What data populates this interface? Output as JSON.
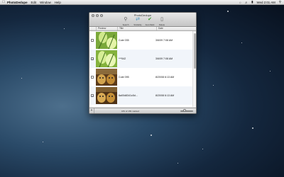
{
  "menubar": {
    "app_name": "PhotoDedupe",
    "menus": [
      "Edit",
      "Window",
      "Help"
    ],
    "clock": "Wed 2:01 AM"
  },
  "window": {
    "title": "PhotoDedupe",
    "toolbar": [
      {
        "label": "Search",
        "icon": "search-icon"
      },
      {
        "label": "Similarity",
        "icon": "similarity-icon"
      },
      {
        "label": "Auto Mark",
        "icon": "auto-mark-icon"
      },
      {
        "label": "Delete",
        "icon": "trash-icon"
      }
    ],
    "columns": [
      "Preview",
      "Title",
      "Date"
    ],
    "rows": [
      {
        "checked": false,
        "title": "Cute 035",
        "date": "3/6/09 7:08 AM",
        "thumb": "leaf"
      },
      {
        "checked": true,
        "title": "***542",
        "date": "3/6/09 7:08 AM",
        "thumb": "leaf"
      },
      {
        "checked": false,
        "title": "Cute 095",
        "date": "8/20/08 6:13 AM",
        "thumb": "cat"
      },
      {
        "checked": true,
        "title": "6a00d8341c5d9969e20120...",
        "date": "8/20/08 6:13 AM",
        "thumb": "cat"
      }
    ],
    "status": "183 of 183 marked"
  },
  "colors": {
    "checkmark": "#1a3f8c",
    "wallpaper": "#14273e"
  }
}
